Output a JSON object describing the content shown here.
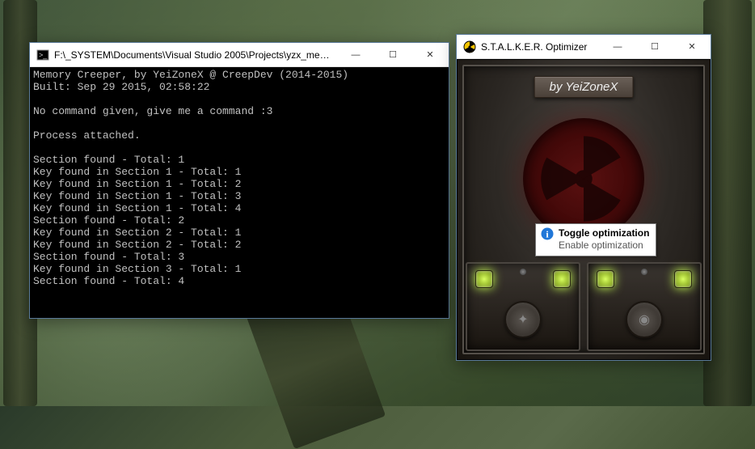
{
  "console": {
    "title": "F:\\_SYSTEM\\Documents\\Visual Studio 2005\\Projects\\yzx_memc...",
    "lines": [
      "Memory Creeper, by YeiZoneX @ CreepDev (2014-2015)",
      "Built: Sep 29 2015, 02:58:22",
      "",
      "No command given, give me a command :3",
      "",
      "Process attached.",
      "",
      "Section found - Total: 1",
      "Key found in Section 1 - Total: 1",
      "Key found in Section 1 - Total: 2",
      "Key found in Section 1 - Total: 3",
      "Key found in Section 1 - Total: 4",
      "Section found - Total: 2",
      "Key found in Section 2 - Total: 1",
      "Key found in Section 2 - Total: 2",
      "Section found - Total: 3",
      "Key found in Section 3 - Total: 1",
      "Section found - Total: 4"
    ]
  },
  "optimizer": {
    "title": "S.T.A.L.K.E.R. Optimizer",
    "credit": "by YeiZoneX",
    "tooltip_title": "Toggle optimization",
    "tooltip_body": "Enable optimization"
  },
  "window_controls": {
    "minimize": "—",
    "maximize": "☐",
    "close": "✕"
  }
}
